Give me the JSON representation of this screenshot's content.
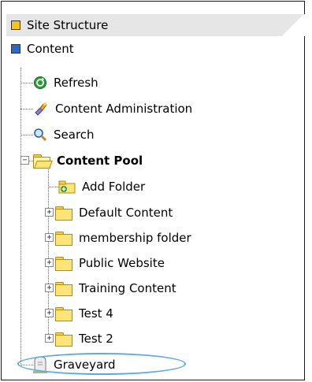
{
  "tabs": [
    {
      "label": "Site Structure",
      "icon": "yellow-square",
      "color": "#f6c31c"
    },
    {
      "label": "Content",
      "icon": "blue-square",
      "color": "#2e67c7"
    }
  ],
  "tree": {
    "refresh": {
      "label": "Refresh",
      "icon": "refresh-icon"
    },
    "content_admin": {
      "label": "Content Administration",
      "icon": "admin-icon"
    },
    "search": {
      "label": "Search",
      "icon": "search-icon"
    },
    "content_pool": {
      "label": "Content Pool",
      "icon": "open-folder-icon",
      "expanded": true
    },
    "add_folder": {
      "label": "Add Folder",
      "icon": "add-folder-icon"
    },
    "folders": [
      {
        "label": "Default Content"
      },
      {
        "label": "membership folder"
      },
      {
        "label": "Public Website"
      },
      {
        "label": "Training Content"
      },
      {
        "label": "Test 4"
      },
      {
        "label": "Test 2"
      }
    ],
    "graveyard": {
      "label": "Graveyard",
      "icon": "graveyard-icon"
    }
  },
  "highlight_color": "#5aa9df"
}
